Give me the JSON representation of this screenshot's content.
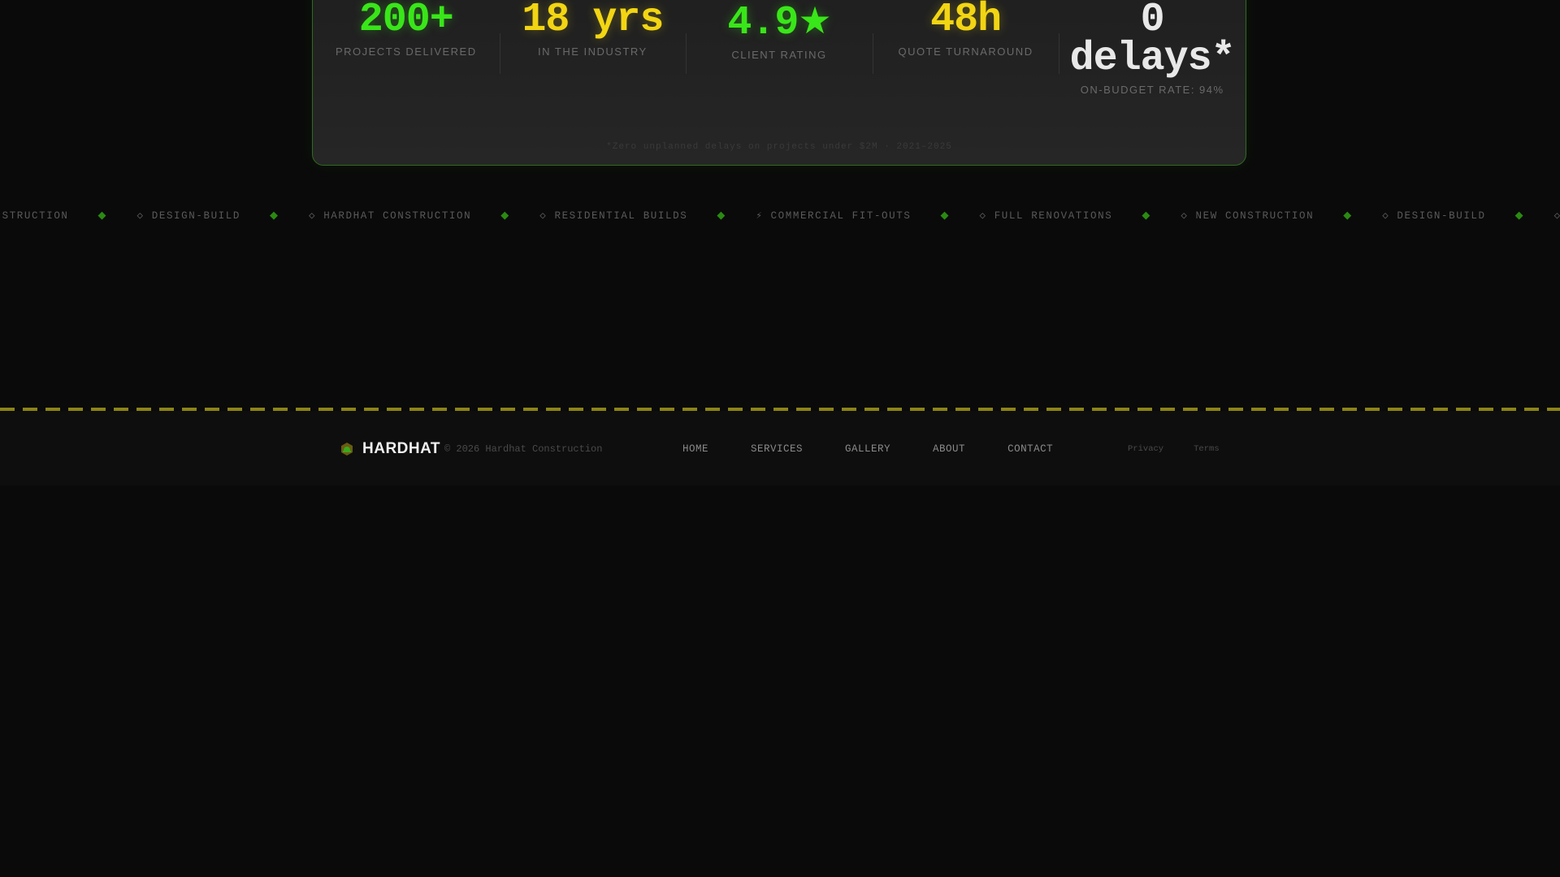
{
  "stats": [
    {
      "value": "200+",
      "label": "PROJECTS DELIVERED",
      "color": "#39e619"
    },
    {
      "value": "18 yrs",
      "label": "IN THE INDUSTRY",
      "color": "#f2d513"
    },
    {
      "value": "4.9",
      "value_suffix": "★",
      "label": "CLIENT RATING",
      "color": "#39e619"
    },
    {
      "value": "48h",
      "label": "QUOTE TURNAROUND",
      "color": "#f2d513"
    },
    {
      "value_line1": "0",
      "value_line2": "delays*",
      "label": "ON-BUDGET RATE: 94%",
      "color": "#e8e8e8"
    }
  ],
  "footnote": "*Zero unplanned delays on projects under $2M · 2021–2025",
  "marquee": {
    "items": [
      "EW CONSTRUCTION",
      "◇ DESIGN-BUILD",
      "◇ HARDHAT CONSTRUCTION",
      "◇ RESIDENTIAL BUILDS",
      "⚡ COMMERCIAL FIT-OUTS",
      "◇ FULL RENOVATIONS",
      "◇ NEW CONSTRUCTION",
      "◇ DESIGN-BUILD",
      "◇ HARDHAT"
    ],
    "separator": "◆",
    "separator_color": "#2a8a12"
  },
  "hazard_color": "#8c8416",
  "footer": {
    "brand_icon": "hardhat-icon",
    "brand_name": "HARDHAT",
    "copyright": "© 2026 Hardhat Construction",
    "nav": [
      "HOME",
      "SERVICES",
      "GALLERY",
      "ABOUT",
      "CONTACT"
    ],
    "legal": [
      "Privacy",
      "Terms"
    ]
  }
}
